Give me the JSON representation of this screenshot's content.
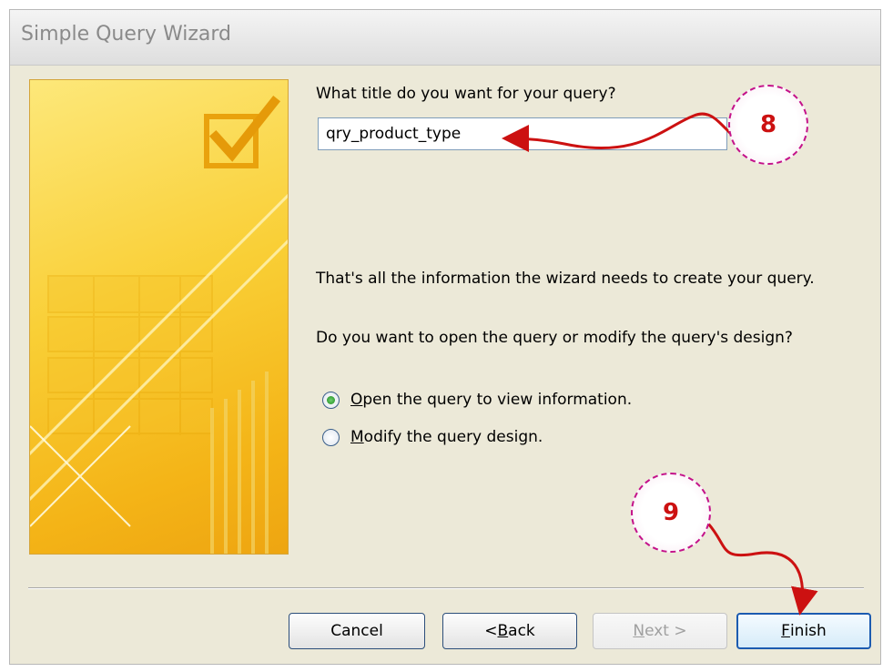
{
  "window": {
    "title": "Simple Query Wizard"
  },
  "prompt_title": "What title do you want for your query?",
  "query_title_value": "qry_product_type",
  "info_line": "That's all the information the wizard needs to create your query.",
  "question_line": "Do you want to open the query or modify the query's design?",
  "options": [
    {
      "mnemonic": "O",
      "rest": "pen the query to view information.",
      "selected": true
    },
    {
      "mnemonic": "M",
      "rest": "odify the query design.",
      "selected": false
    }
  ],
  "buttons": {
    "cancel": {
      "label": "Cancel"
    },
    "back": {
      "prefix": "< ",
      "mnemonic": "B",
      "rest": "ack"
    },
    "next": {
      "mnemonic": "N",
      "rest": "ext >",
      "disabled": true
    },
    "finish": {
      "mnemonic": "F",
      "rest": "inish"
    }
  },
  "annotations": {
    "step_8": "8",
    "step_9": "9"
  },
  "colors": {
    "annotation_ring": "#c4128a",
    "annotation_arrow": "#cc1111",
    "art_gold": "#f4b417"
  },
  "icons": {
    "art_checkmark": "checkmark-icon"
  }
}
